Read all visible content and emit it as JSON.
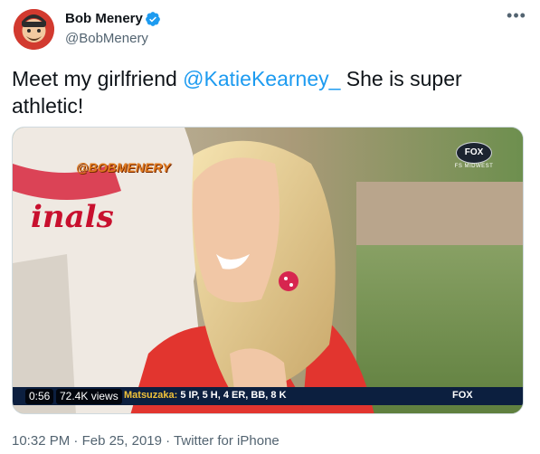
{
  "author": {
    "name": "Bob Menery",
    "handle": "@BobMenery",
    "verified": true
  },
  "tweet": {
    "text_before": "Meet my girlfriend ",
    "mention": "@KatieKearney_",
    "text_after": " She is super athletic!"
  },
  "media": {
    "watermark": "@BOBMENERY",
    "tv_logo": "FOX",
    "tv_network": "FS MIDWEST",
    "ticker_name": "Matsuzaka:",
    "ticker_stats": " 5 IP, 5 H, 4 ER, BB, 8 K",
    "ticker_logo": "FOX",
    "duration": "0:56",
    "views": "72.4K views"
  },
  "meta": {
    "time": "10:32 PM",
    "date": "Feb 25, 2019",
    "source": "Twitter for iPhone",
    "separator": " · "
  },
  "colors": {
    "accent": "#1d9bf0",
    "secondary_text": "#536471",
    "ticker_bg": "#0c1f3f",
    "ticker_name": "#f0c23a"
  },
  "icons": [
    "verified-badge-icon",
    "more-options-icon"
  ]
}
